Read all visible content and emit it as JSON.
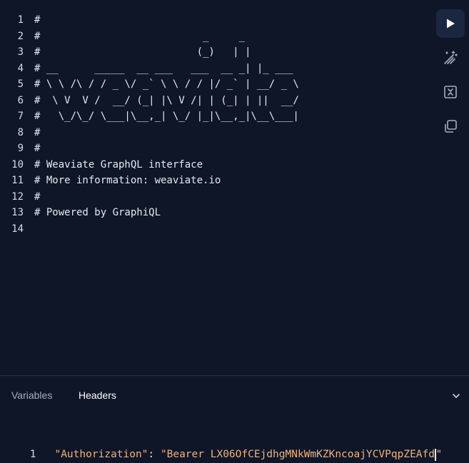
{
  "editor": {
    "lines": [
      {
        "num": "1",
        "text": "#"
      },
      {
        "num": "2",
        "text": "#                           _     _"
      },
      {
        "num": "3",
        "text": "#                          (_)   | |"
      },
      {
        "num": "4",
        "text": "# __      _____  __ ___   ___  __ _| |_ ___"
      },
      {
        "num": "5",
        "text": "# \\ \\ /\\ / / _ \\/ _` \\ \\ / / |/ _` | __/ _ \\"
      },
      {
        "num": "6",
        "text": "#  \\ V  V /  __/ (_| |\\ V /| | (_| | ||  __/"
      },
      {
        "num": "7",
        "text": "#   \\_/\\_/ \\___|\\__,_| \\_/ |_|\\__,_|\\__\\___|"
      },
      {
        "num": "8",
        "text": "#"
      },
      {
        "num": "9",
        "text": "#"
      },
      {
        "num": "10",
        "text": "# Weaviate GraphQL interface"
      },
      {
        "num": "11",
        "text": "# More information: weaviate.io"
      },
      {
        "num": "12",
        "text": "#"
      },
      {
        "num": "13",
        "text": "# Powered by GraphiQL"
      },
      {
        "num": "14",
        "text": ""
      }
    ]
  },
  "toolbar": {
    "items": [
      {
        "name": "run",
        "icon": "play-icon"
      },
      {
        "name": "prettify",
        "icon": "magic-wand-icon"
      },
      {
        "name": "merge-fragments",
        "icon": "merge-icon"
      },
      {
        "name": "copy",
        "icon": "copy-icon"
      }
    ]
  },
  "bottom_panel": {
    "tabs": [
      {
        "label": "Variables",
        "active": false
      },
      {
        "label": "Headers",
        "active": true
      }
    ],
    "toggle_icon": "chevron-down-icon",
    "headers_editor": {
      "line_num": "1",
      "key": "\"Authorization\"",
      "colon": ": ",
      "value": "\"Bearer LX06OfCEjdhgMNkWmKZKncoajYCVPqpZEAfd",
      "closing_quote": "\""
    }
  },
  "colors": {
    "background": "#0f1628",
    "string": "#f0b27a",
    "active_button": "#1b2740"
  }
}
